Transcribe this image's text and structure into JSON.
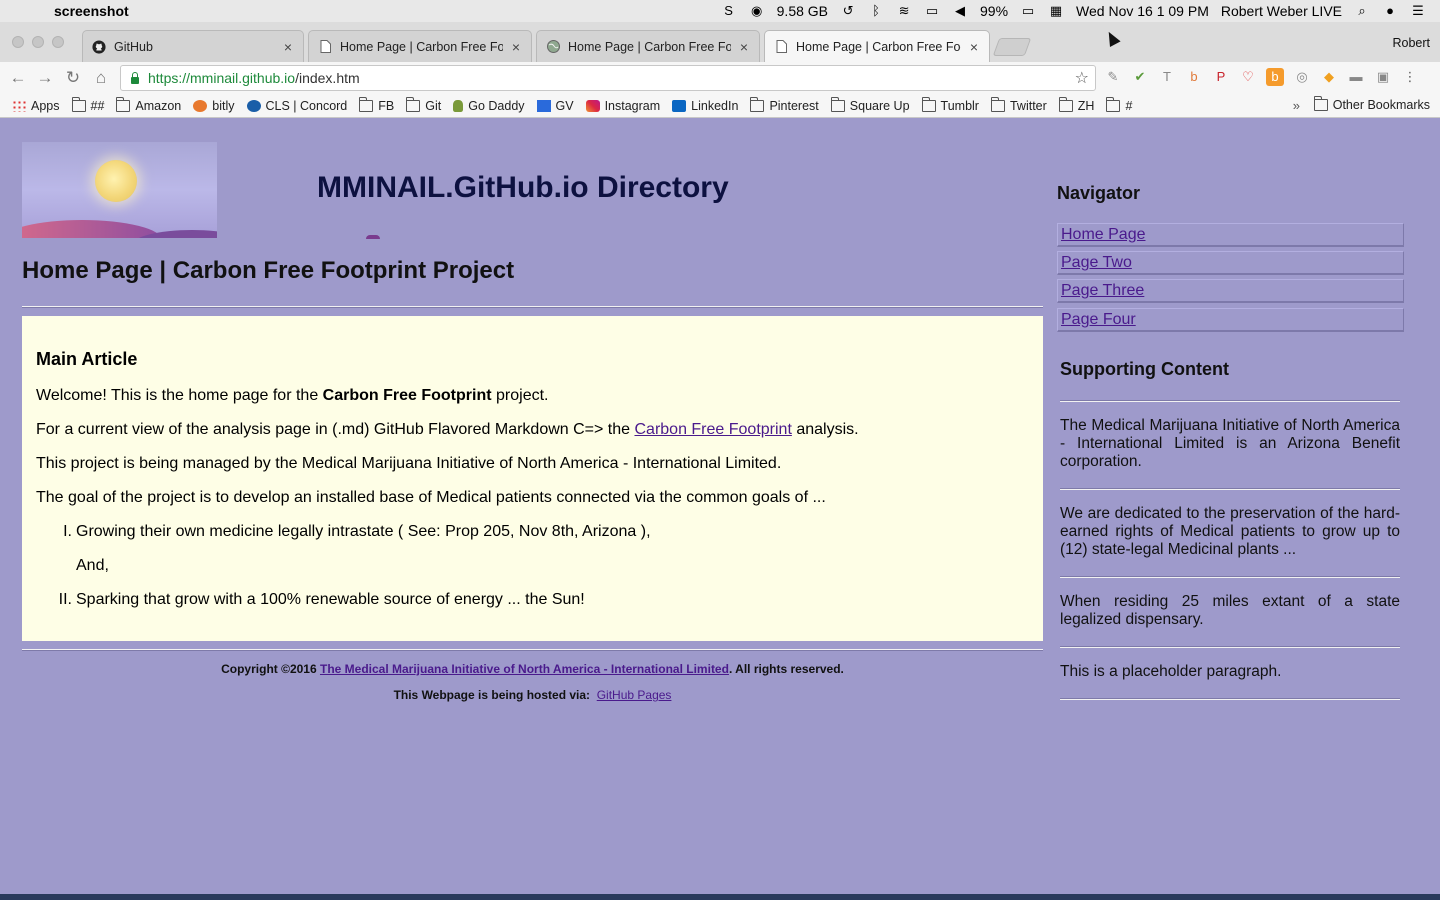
{
  "menubar": {
    "app_name": "screenshot",
    "memory": "9.58 GB",
    "battery": "99%",
    "datetime": "Wed Nov 16  1 09 PM",
    "user": "Robert Weber LIVE"
  },
  "tabs": [
    {
      "title": "GitHub",
      "icon": "github-icon"
    },
    {
      "title": "Home Page | Carbon Free Foot",
      "icon": "page-icon"
    },
    {
      "title": "Home Page | Carbon Free Foot",
      "icon": "globe-icon"
    },
    {
      "title": "Home Page | Carbon Free Foot",
      "icon": "page-icon",
      "active": true
    }
  ],
  "profile": "Robert",
  "address": {
    "domain": "https://mminail.github.io",
    "path": "/index.htm"
  },
  "bookmarks": [
    {
      "label": "Apps",
      "icon": "apps-grid-icon"
    },
    {
      "label": "##",
      "icon": "folder-icon"
    },
    {
      "label": "Amazon",
      "icon": "folder-icon"
    },
    {
      "label": "bitly",
      "icon": "bitly-icon"
    },
    {
      "label": "CLS | Concord",
      "icon": "cls-icon"
    },
    {
      "label": "FB",
      "icon": "folder-icon"
    },
    {
      "label": "Git",
      "icon": "folder-icon"
    },
    {
      "label": "Go Daddy",
      "icon": "godaddy-icon"
    },
    {
      "label": "GV",
      "icon": "gv-icon"
    },
    {
      "label": "Instagram",
      "icon": "instagram-icon"
    },
    {
      "label": "LinkedIn",
      "icon": "linkedin-icon"
    },
    {
      "label": "Pinterest",
      "icon": "folder-icon"
    },
    {
      "label": "Square Up",
      "icon": "folder-icon"
    },
    {
      "label": "Tumblr",
      "icon": "folder-icon"
    },
    {
      "label": "Twitter",
      "icon": "folder-icon"
    },
    {
      "label": "ZH",
      "icon": "folder-icon"
    },
    {
      "label": "#",
      "icon": "folder-icon"
    }
  ],
  "bookmarks_more": "»",
  "bookmarks_other": "Other Bookmarks",
  "site": {
    "title": "MMINAIL.GitHub.io Directory",
    "page_heading": "Home Page | Carbon Free Footprint Project"
  },
  "article": {
    "heading": "Main Article",
    "p1_before": "Welcome! This is the home page for the ",
    "p1_bold": "Carbon Free Footprint",
    "p1_after": " project.",
    "p2_before": "For a current view of the analysis page in (.md) GitHub Flavored Markdown C=> the ",
    "p2_link": "Carbon Free Footprint",
    "p2_after": " analysis.",
    "p3": "This project is being managed by the Medical Marijuana Initiative of North America - International Limited.",
    "p4": "The goal of the project is to develop an installed base of Medical patients connected via the common goals of ...",
    "item1_num": "I.",
    "item1": "Growing their own medicine legally intrastate ( See: Prop 205, Nov 8th, Arizona ),",
    "item_and": "And,",
    "item2_num": "II.",
    "item2": "Sparking that grow with a 100% renewable source of energy ... the Sun!"
  },
  "footer": {
    "copyright_prefix": "Copyright ©2016 ",
    "copyright_link": "The Medical Marijuana Initiative of North America - International Limited",
    "copyright_suffix": ". All rights reserved.",
    "hosted_prefix": "This Webpage is being hosted via:  ",
    "hosted_link": "GitHub Pages"
  },
  "sidebar": {
    "nav_heading": "Navigator",
    "nav_items": [
      "Home Page",
      "Page Two",
      "Page Three",
      "Page Four"
    ],
    "support_heading": "Supporting Content",
    "paragraphs": [
      "The Medical Marijuana Initiative of North America - International Limited is an Arizona Benefit corporation.",
      "We are dedicated to the preservation of the hard-earned rights of Medical patients to grow up to (12) state-legal Medicinal plants ...",
      "When residing 25 miles extant of a state legalized dispensary.",
      "This is a placeholder paragraph."
    ]
  },
  "colors": {
    "page_bg": "#9e9acb",
    "article_bg": "#fefee6",
    "link": "#4a1a8c",
    "title": "#0d1140"
  }
}
